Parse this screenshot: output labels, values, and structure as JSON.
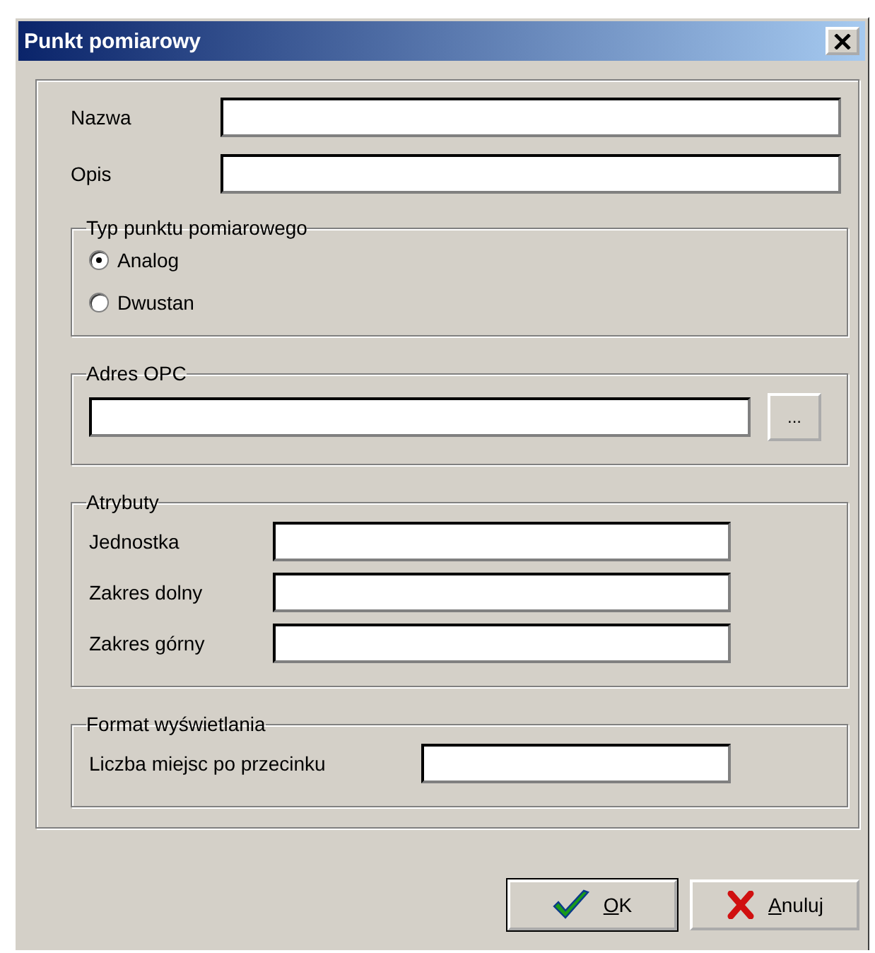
{
  "window": {
    "title": "Punkt pomiarowy"
  },
  "general": {
    "fields": [
      {
        "label": "Nazwa"
      },
      {
        "label": "Opis"
      }
    ]
  },
  "point_type": {
    "legend": "Typ punktu pomiarowego",
    "options": [
      {
        "label": "Analog",
        "selected": true
      },
      {
        "label": "Dwustan",
        "selected": false
      }
    ]
  },
  "opc_address": {
    "legend": "Adres OPC",
    "browse_button": "..."
  },
  "attributes": {
    "legend": "Atrybuty",
    "fields": [
      {
        "label": "Jednostka"
      },
      {
        "label": "Zakres dolny"
      },
      {
        "label": "Zakres górny"
      }
    ]
  },
  "display_format": {
    "legend": "Format wyświetlania",
    "fields": [
      {
        "label": "Liczba miejsc po przecinku"
      }
    ]
  },
  "buttons": [
    {
      "label": "OK",
      "kind": "ok"
    },
    {
      "label": "Anuluj",
      "kind": "cancel"
    }
  ]
}
